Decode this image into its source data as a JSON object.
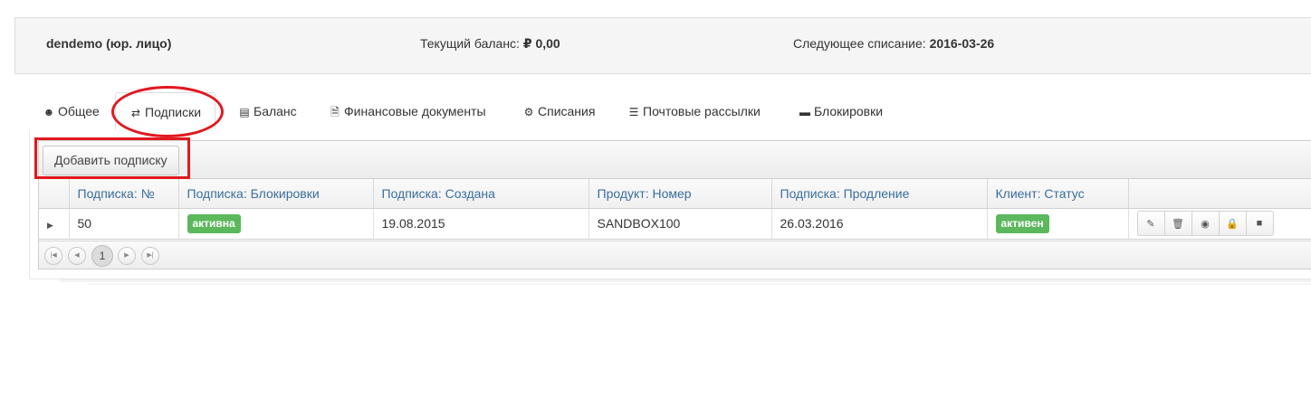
{
  "infobar": {
    "account": "dendemo (юр. лицо)",
    "balance_label": "Текущий баланс:",
    "balance_value": "₽ 0,00",
    "next_label": "Следующее списание:",
    "next_value": "2016-03-26"
  },
  "tabs": [
    {
      "label": "Общее",
      "icon": "user-icon"
    },
    {
      "label": "Подписки",
      "icon": "retweet-icon",
      "active": true
    },
    {
      "label": "Баланс",
      "icon": "money-icon"
    },
    {
      "label": "Финансовые документы",
      "icon": "file-icon"
    },
    {
      "label": "Списания",
      "icon": "gear-icon"
    },
    {
      "label": "Почтовые рассылки",
      "icon": "list-icon"
    },
    {
      "label": "Блокировки",
      "icon": "minus-square-icon"
    }
  ],
  "toolbar": {
    "add_label": "Добавить подписку"
  },
  "table": {
    "columns": [
      "Подписка: №",
      "Подписка: Блокировки",
      "Подписка: Создана",
      "Продукт: Номер",
      "Подписка: Продление",
      "Клиент: Статус"
    ],
    "rows": [
      {
        "id": "50",
        "block": "активна",
        "created": "19.08.2015",
        "product": "SANDBOX100",
        "renewal": "26.03.2016",
        "status": "активен"
      }
    ],
    "actions": [
      "edit-icon",
      "trash-icon",
      "dashboard-icon",
      "lock-icon",
      "stop-icon"
    ]
  },
  "pager": {
    "current_page": "1"
  },
  "colors": {
    "accent_link": "#3a6e9e",
    "label_green": "#5cb85c",
    "highlight_red": "#e0191f"
  }
}
